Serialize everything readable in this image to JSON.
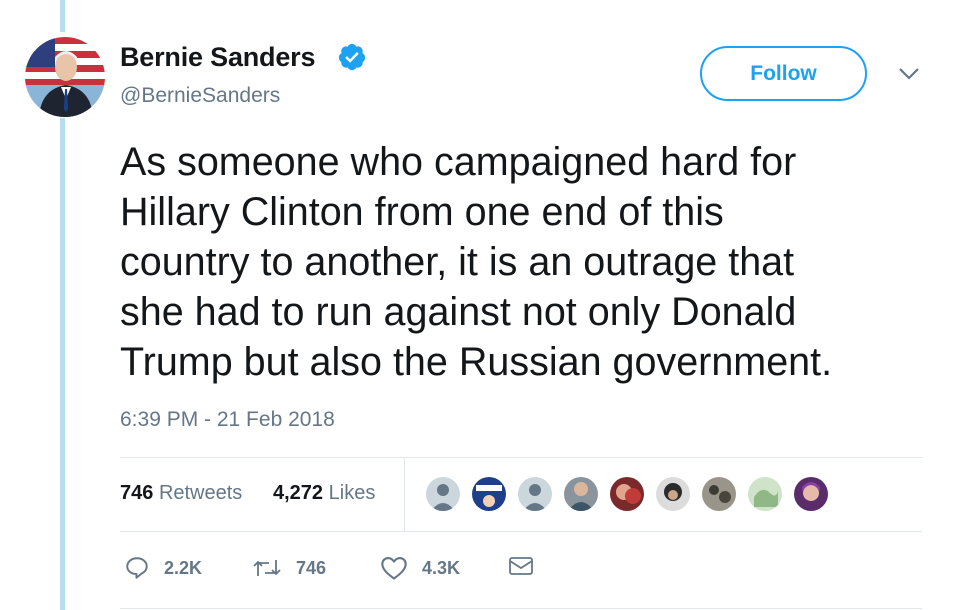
{
  "author": {
    "name": "Bernie Sanders",
    "handle": "@BernieSanders",
    "verified": true
  },
  "follow_label": "Follow",
  "tweet": {
    "lines": [
      "As someone who campaigned hard for",
      "Hillary Clinton from one end of this",
      "country to another, it is an outrage that",
      "she had to run against not only Donald",
      "Trump but also the Russian government."
    ]
  },
  "timestamp": "6:39 PM - 21 Feb 2018",
  "stats": {
    "retweets_count": "746",
    "retweets_label": "Retweets",
    "likes_count": "4,272",
    "likes_label": "Likes"
  },
  "likers": [
    {
      "icon": "default-avatar-icon",
      "color": "#ccd6dd"
    },
    {
      "icon": "campaign-logo-avatar",
      "color": "#1f3f8a"
    },
    {
      "icon": "default-avatar-icon",
      "color": "#ccd6dd"
    },
    {
      "icon": "user-photo-avatar",
      "color": "#5c6b78"
    },
    {
      "icon": "user-photo-avatar",
      "color": "#b03a3a"
    },
    {
      "icon": "user-photo-avatar",
      "color": "#3b3b3b"
    },
    {
      "icon": "user-photo-avatar",
      "color": "#6e6a60"
    },
    {
      "icon": "user-photo-avatar",
      "color": "#a7c7a0"
    },
    {
      "icon": "user-photo-avatar",
      "color": "#6b3a7a"
    }
  ],
  "actions": {
    "reply": "2.2K",
    "retweet": "746",
    "like": "4.3K"
  },
  "colors": {
    "accent": "#1da1f2",
    "thread_line": "#b8dcf2",
    "secondary_text": "#657786",
    "divider": "#e1e8ed"
  }
}
